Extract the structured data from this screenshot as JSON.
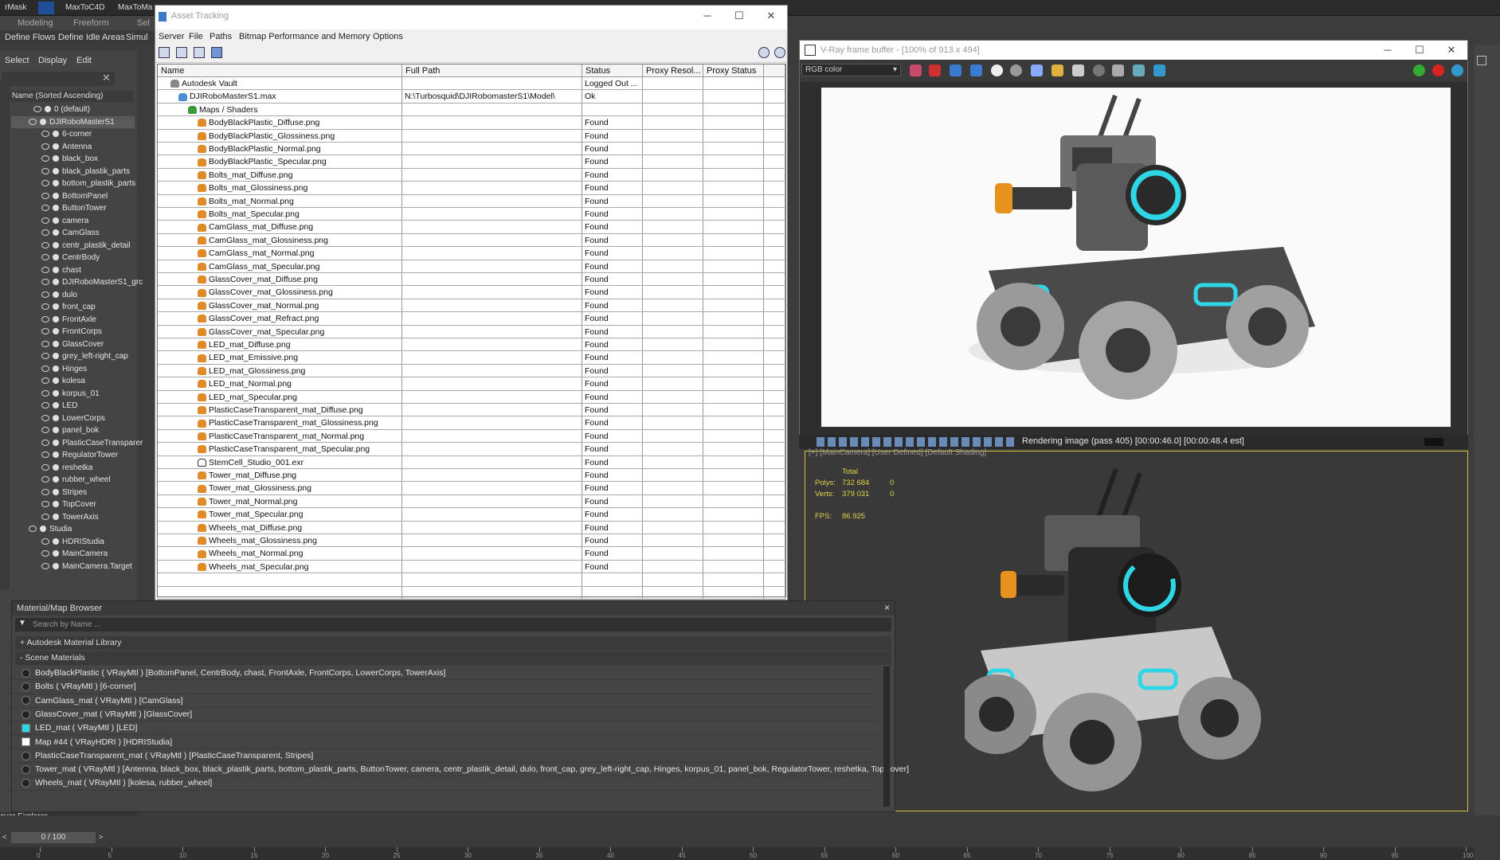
{
  "top_bar": {
    "tabs": [
      "rMask",
      "MaxToC4D",
      "MaxToMa"
    ]
  },
  "ribbon": {
    "row1": [
      "Modeling",
      "Freeform",
      "Sel"
    ],
    "row2": [
      "Define Flows",
      "Define Idle Areas",
      "Simul"
    ]
  },
  "scene_explorer": {
    "menu": [
      "Select",
      "Display",
      "Edit"
    ],
    "column_header": "Name (Sorted Ascending)",
    "items": [
      "0 (default)",
      "DJIRoboMasterS1",
      "6-corner",
      "Antenna",
      "black_box",
      "black_plastik_parts",
      "bottom_plastik_parts",
      "BottomPanel",
      "ButtonTower",
      "camera",
      "CamGlass",
      "centr_plastik_detail",
      "CentrBody",
      "chast",
      "DJIRoboMasterS1_grc",
      "dulo",
      "front_cap",
      "FrontAxle",
      "FrontCorps",
      "GlassCover",
      "grey_left-right_cap",
      "Hinges",
      "kolesa",
      "korpus_01",
      "LED",
      "LowerCorps",
      "panel_bok",
      "PlasticCaseTransparer",
      "RegulatorTower",
      "reshetka",
      "rubber_wheel",
      "Stripes",
      "TopCover",
      "TowerAxis",
      "Studia",
      "HDRIStudia",
      "MainCamera",
      "MainCamera.Target"
    ],
    "footer": "ayer Explorer"
  },
  "asset_tracking": {
    "title": "Asset Tracking",
    "menu": [
      "Server",
      "File",
      "Paths",
      "Bitmap Performance and Memory",
      "Options"
    ],
    "columns": [
      "Name",
      "Full Path",
      "Status",
      "Proxy Resol...",
      "Proxy Status"
    ],
    "vault": {
      "name": "Autodesk Vault",
      "status": "Logged Out ..."
    },
    "file": {
      "name": "DJIRoboMasterS1.max",
      "path": "N:\\Turbosquid\\DJIRobomasterS1\\Model\\",
      "status": "Ok"
    },
    "group": "Maps / Shaders",
    "maps": [
      "BodyBlackPlastic_Diffuse.png",
      "BodyBlackPlastic_Glossiness.png",
      "BodyBlackPlastic_Normal.png",
      "BodyBlackPlastic_Specular.png",
      "Bolts_mat_Diffuse.png",
      "Bolts_mat_Glossiness.png",
      "Bolts_mat_Normal.png",
      "Bolts_mat_Specular.png",
      "CamGlass_mat_Diffuse.png",
      "CamGlass_mat_Glossiness.png",
      "CamGlass_mat_Normal.png",
      "CamGlass_mat_Specular.png",
      "GlassCover_mat_Diffuse.png",
      "GlassCover_mat_Glossiness.png",
      "GlassCover_mat_Normal.png",
      "GlassCover_mat_Refract.png",
      "GlassCover_mat_Specular.png",
      "LED_mat_Diffuse.png",
      "LED_mat_Emissive.png",
      "LED_mat_Glossiness.png",
      "LED_mat_Normal.png",
      "LED_mat_Specular.png",
      "PlasticCaseTransparent_mat_Diffuse.png",
      "PlasticCaseTransparent_mat_Glossiness.png",
      "PlasticCaseTransparent_mat_Normal.png",
      "PlasticCaseTransparent_mat_Specular.png",
      "StemCell_Studio_001.exr",
      "Tower_mat_Diffuse.png",
      "Tower_mat_Glossiness.png",
      "Tower_mat_Normal.png",
      "Tower_mat_Specular.png",
      "Wheels_mat_Diffuse.png",
      "Wheels_mat_Glossiness.png",
      "Wheels_mat_Normal.png",
      "Wheels_mat_Specular.png"
    ],
    "map_status": "Found"
  },
  "vray_fb": {
    "title": "V-Ray frame buffer - [100% of 913 x 494]",
    "channel": "RGB color",
    "status": "Rendering image (pass 405) [00:00:46.0] [00:00:48.4 est]"
  },
  "viewport": {
    "label": "[+] [MainCamera] [User Defined] [Default Shading]",
    "total_label": "Total",
    "polys_label": "Polys:",
    "polys": "732 684",
    "polys_sel": "0",
    "verts_label": "Verts:",
    "verts": "379 031",
    "verts_sel": "0",
    "fps_label": "FPS:",
    "fps": "86.925"
  },
  "material_browser": {
    "title": "Material/Map Browser",
    "search_placeholder": "Search by Name ...",
    "library": "+ Autodesk Material Library",
    "scene_section": "- Scene Materials",
    "materials": [
      "BodyBlackPlastic ( VRayMtl ) [BottomPanel, CentrBody, chast, FrontAxle, FrontCorps, LowerCorps, TowerAxis]",
      "Bolts ( VRayMtl ) [6-corner]",
      "CamGlass_mat ( VRayMtl ) [CamGlass]",
      "GlassCover_mat ( VRayMtl ) [GlassCover]",
      "LED_mat ( VRayMtl ) [LED]",
      "Map #44 ( VRayHDRI ) [HDRIStudia]",
      "PlasticCaseTransparent_mat ( VRayMtl ) [PlasticCaseTransparent, Stripes]",
      "Tower_mat ( VRayMtl ) [Antenna, black_box, black_plastik_parts, bottom_plastik_parts, ButtonTower, camera, centr_plastik_detail, dulo, front_cap, grey_left-right_cap, Hinges, korpus_01, panel_bok, RegulatorTower, reshetka, TopCover]",
      "Wheels_mat ( VRayMtl ) [kolesa, rubber_wheel]"
    ]
  },
  "timeline": {
    "frame": "0 / 100",
    "ticks": [
      "0",
      "5",
      "10",
      "15",
      "20",
      "25",
      "30",
      "35",
      "40",
      "45",
      "50",
      "55",
      "60",
      "65",
      "70",
      "75",
      "80",
      "85",
      "90",
      "95",
      "100"
    ]
  },
  "colors": {
    "accent": "#d6c43a",
    "led_cyan": "#2fd6e6",
    "map_icon": "#e08a2a"
  }
}
